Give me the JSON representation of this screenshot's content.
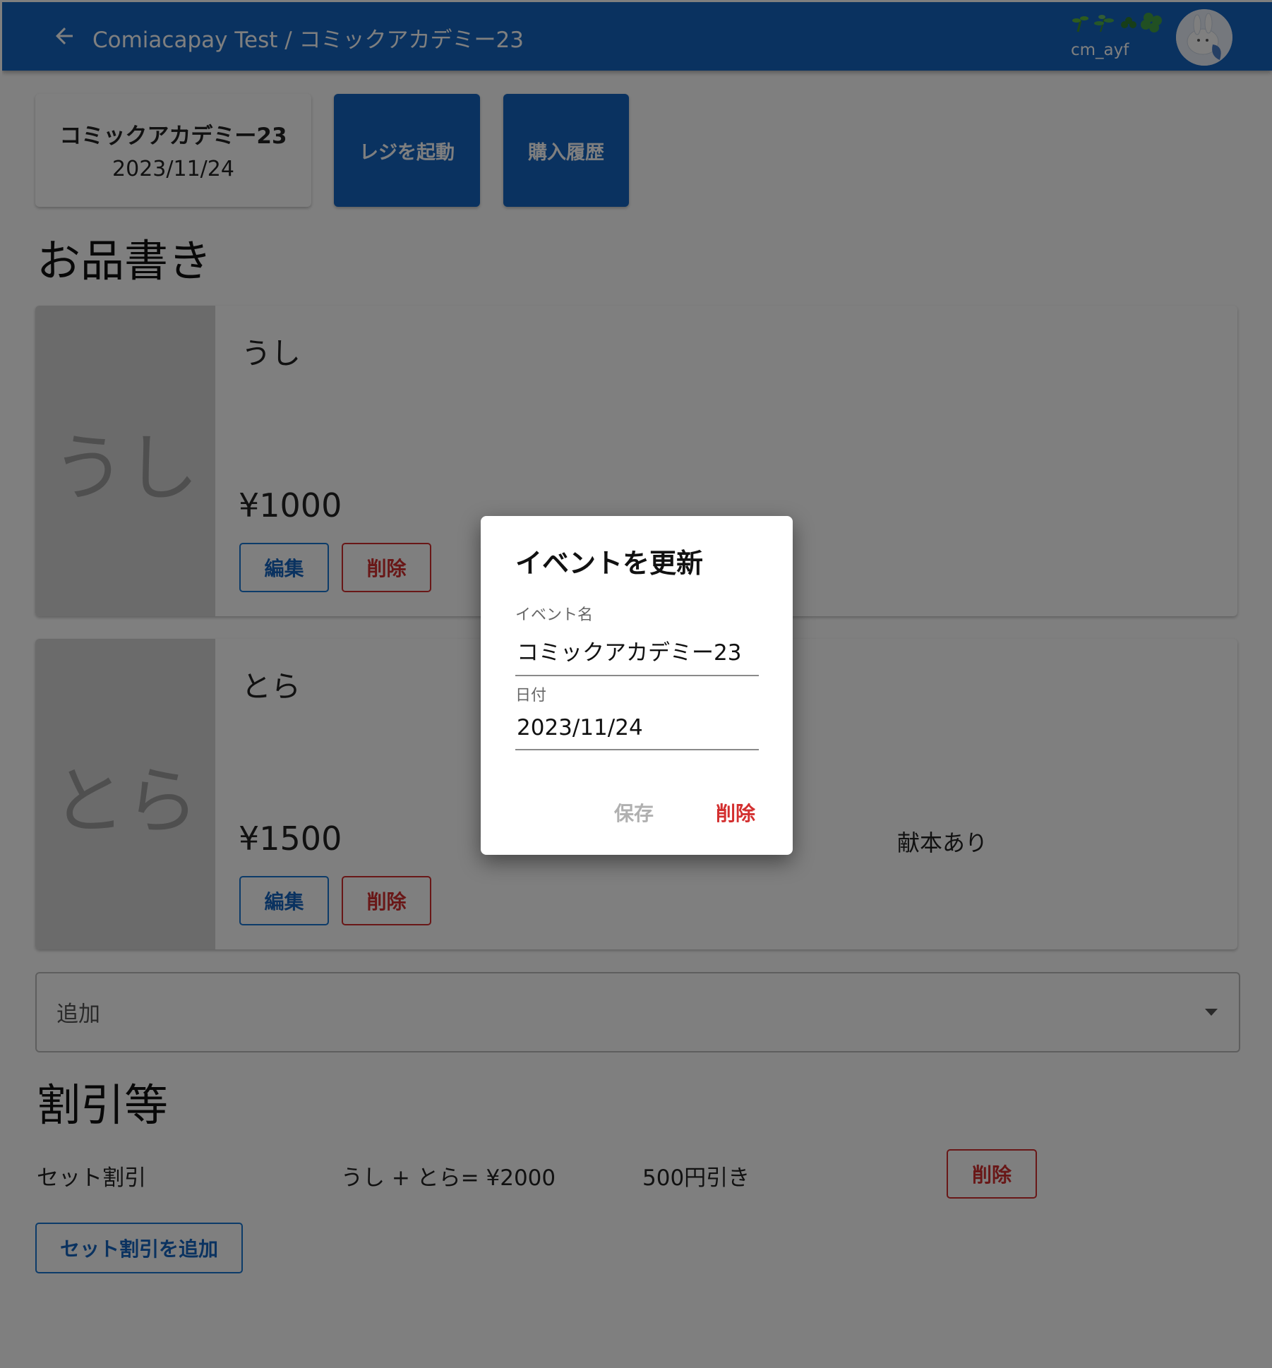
{
  "header": {
    "breadcrumb": "Comiacapay Test / コミックアカデミー23",
    "user_name": "cm_ayf",
    "user_emoji": "🌱🌿☘️🍀"
  },
  "event": {
    "name": "コミックアカデミー23",
    "date": "2023/11/24"
  },
  "actions": {
    "register_label": "レジを起動",
    "history_label": "購入履歴"
  },
  "menu": {
    "title": "お品書き",
    "items": [
      {
        "thumb": "うし",
        "name": "うし",
        "price": "¥1000",
        "note": "",
        "edit_label": "編集",
        "delete_label": "削除"
      },
      {
        "thumb": "とら",
        "name": "とら",
        "price": "¥1500",
        "note": "献本あり",
        "edit_label": "編集",
        "delete_label": "削除"
      }
    ],
    "add_label": "追加"
  },
  "discounts": {
    "title": "割引等",
    "rows": [
      {
        "type": "セット割引",
        "items": "うし + とら= ¥2000",
        "amount": "500円引き",
        "delete_label": "削除"
      }
    ],
    "add_button_label": "セット割引を追加"
  },
  "dialog": {
    "title": "イベントを更新",
    "name_label": "イベント名",
    "name_value": "コミックアカデミー23",
    "date_label": "日付",
    "date_value": "2023/11/24",
    "save_label": "保存",
    "delete_label": "削除"
  },
  "colors": {
    "primary": "#1565c0",
    "danger": "#d32f2f",
    "overlay": "rgba(0,0,0,0.5)"
  }
}
